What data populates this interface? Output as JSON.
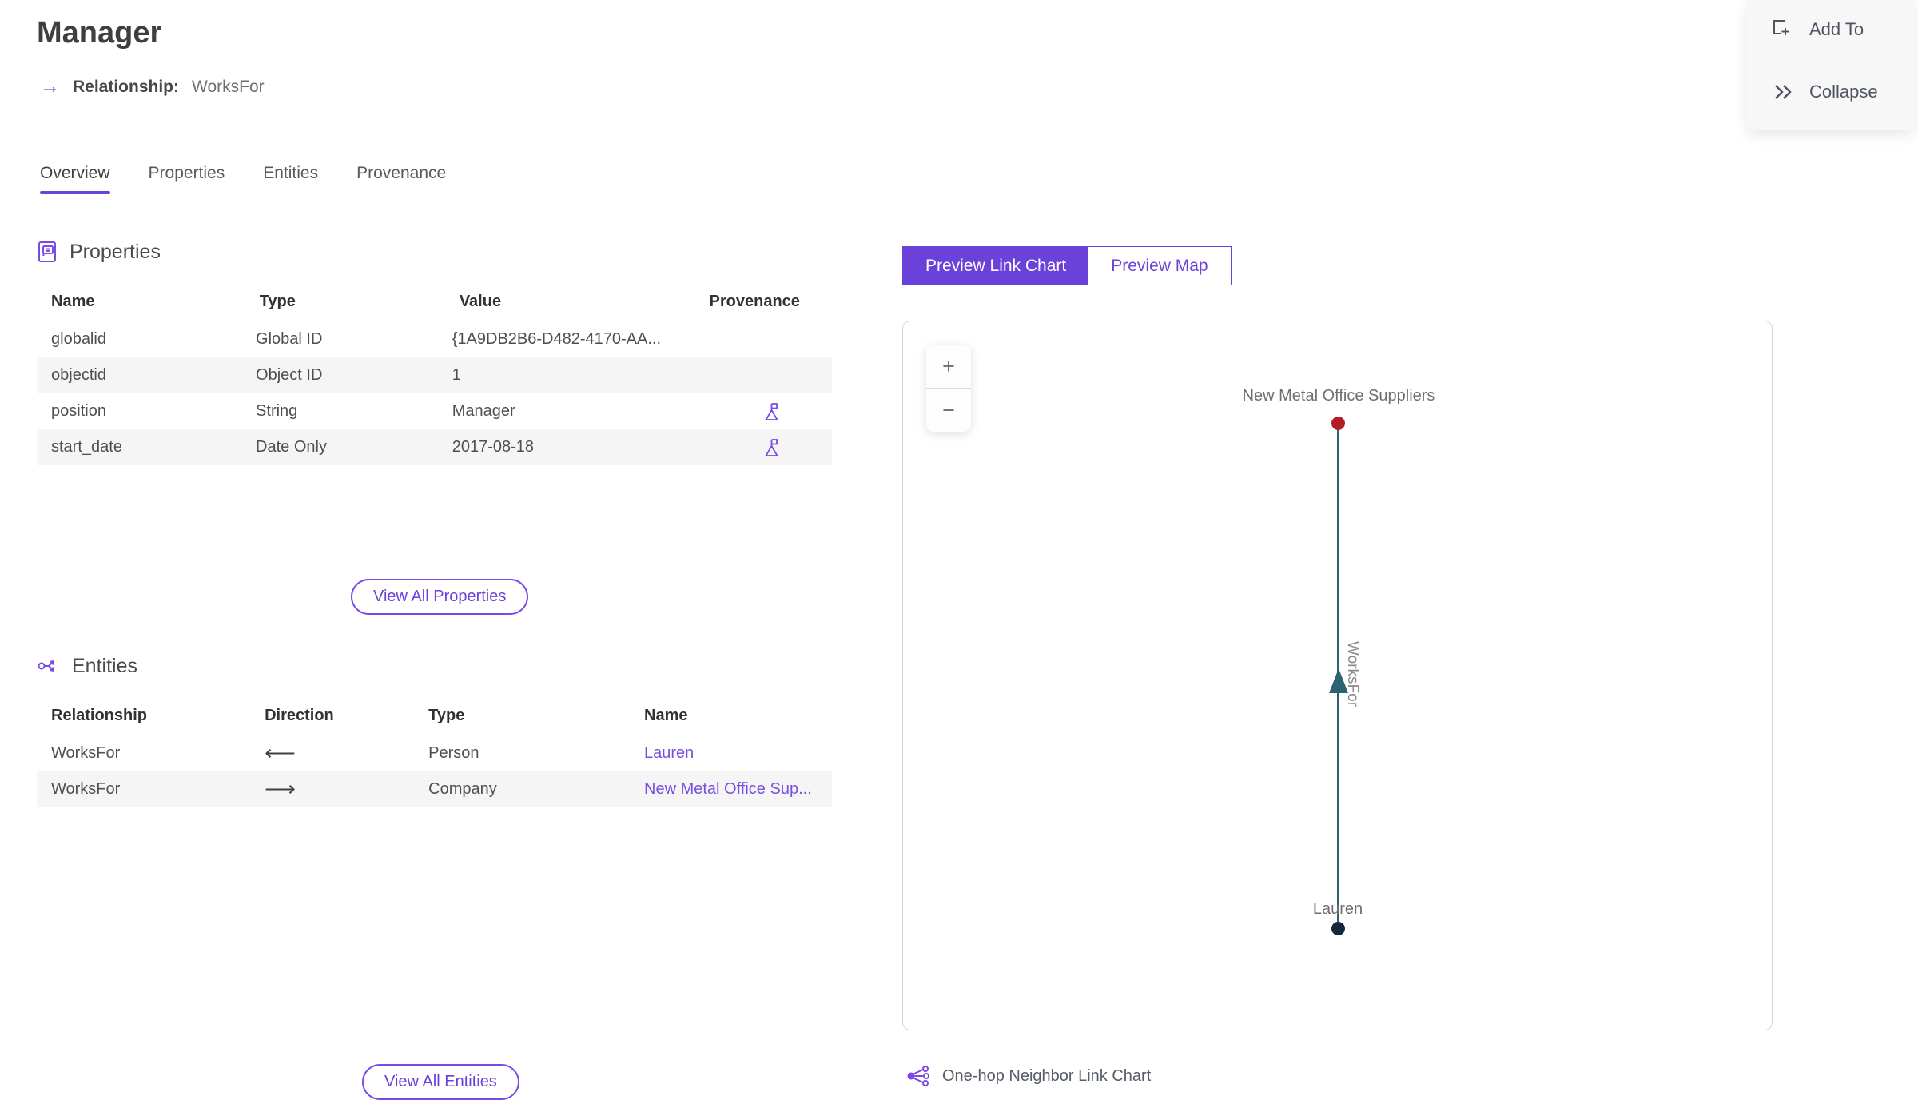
{
  "header": {
    "title": "Manager",
    "subtitle_label": "Relationship:",
    "subtitle_value": "WorksFor",
    "subtitle_arrow": "→"
  },
  "actions": {
    "add_to_label": "Add To",
    "collapse_label": "Collapse"
  },
  "tabs": [
    {
      "label": "Overview",
      "active": true
    },
    {
      "label": "Properties",
      "active": false
    },
    {
      "label": "Entities",
      "active": false
    },
    {
      "label": "Provenance",
      "active": false
    }
  ],
  "properties_section": {
    "title": "Properties",
    "columns": {
      "name": "Name",
      "type": "Type",
      "value": "Value",
      "provenance": "Provenance"
    },
    "rows": [
      {
        "name": "globalid",
        "type": "Global ID",
        "value": "{1A9DB2B6-D482-4170-AA...",
        "has_provenance": false
      },
      {
        "name": "objectid",
        "type": "Object ID",
        "value": "1",
        "has_provenance": false
      },
      {
        "name": "position",
        "type": "String",
        "value": "Manager",
        "has_provenance": true
      },
      {
        "name": "start_date",
        "type": "Date Only",
        "value": "2017-08-18",
        "has_provenance": true
      }
    ],
    "view_all_label": "View All Properties"
  },
  "entities_section": {
    "title": "Entities",
    "columns": {
      "relationship": "Relationship",
      "direction": "Direction",
      "type": "Type",
      "name": "Name"
    },
    "rows": [
      {
        "relationship": "WorksFor",
        "direction_arrow": "⟵",
        "type": "Person",
        "name": "Lauren"
      },
      {
        "relationship": "WorksFor",
        "direction_arrow": "⟶",
        "type": "Company",
        "name": "New Metal Office Sup..."
      }
    ],
    "view_all_label": "View All Entities"
  },
  "preview": {
    "link_chart_tab": "Preview Link Chart",
    "map_tab": "Preview Map",
    "zoom_in": "+",
    "zoom_out": "−",
    "caption": "One-hop Neighbor Link Chart"
  },
  "link_chart": {
    "nodes": [
      {
        "label": "New Metal Office Suppliers",
        "type": "Company",
        "dot_color": "#b01e24"
      },
      {
        "label": "Lauren",
        "type": "Person",
        "dot_color": "#17273b"
      }
    ],
    "edge": {
      "label": "WorksFor",
      "color": "#2b6372",
      "direction": "from Lauren up to New Metal Office Suppliers"
    }
  },
  "colors": {
    "accent_purple": "#6a42d9",
    "outline_purple": "#7a49e8",
    "link_purple": "#7a4fe0",
    "edge_teal": "#2b6372",
    "node_red": "#b01e24",
    "node_navy": "#17273b"
  }
}
